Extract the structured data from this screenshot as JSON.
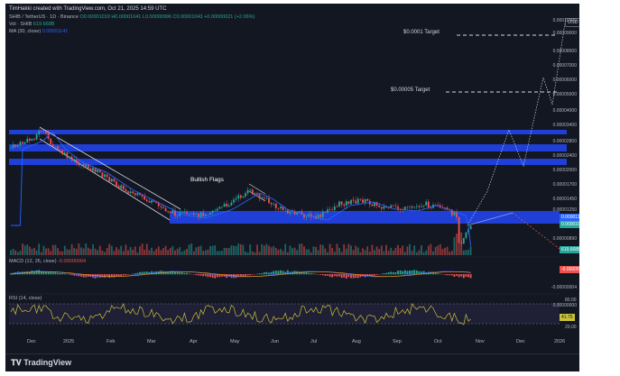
{
  "header": {
    "credit": "TimHakki created with TradingView.com, Oct 21, 2025 14:59 UTC",
    "symbol": "SHIB / TetherUS · 1D · Binance",
    "ohlc": "O0.00001019  H0.00001041  L0.00000996  C0.00001043  +0.00000021 (+2.06%)",
    "vol_label": "Vol · SHIB",
    "vol_value": "619.668B",
    "ma_label": "MA (30, close)",
    "ma_value": "0.00001141",
    "currency": "USDT"
  },
  "price_axis": [
    "0.00010000",
    "0.00009000",
    "0.00008000",
    "0.00007000",
    "0.00006000",
    "0.00005000",
    "0.00004000",
    "0.00003400",
    "0.00002800",
    "0.00002400",
    "0.00002000",
    "0.00001700",
    "0.00001450",
    "0.00001250",
    "0.00000890",
    "0.00000000"
  ],
  "badges": {
    "ma": "0.00001141",
    "price": "0.00001040",
    "volume": "619.668B",
    "macd": "-0.00000004",
    "rsi": "41.75"
  },
  "annotations": {
    "target_high": "$0.0001 Target",
    "target_mid": "$0.00005 Target",
    "pattern": "Bullish Flags"
  },
  "macd": {
    "label": "MACD (12, 26, close)",
    "value": "-0.00000004"
  },
  "rsi": {
    "label": "RSI (14, close)",
    "value": "41.75",
    "upper": "80.00",
    "lower": "20.00"
  },
  "time_axis": [
    "Dec",
    "2025",
    "Feb",
    "Mar",
    "Apr",
    "May",
    "Jun",
    "Jul",
    "Aug",
    "Sep",
    "Oct",
    "Nov",
    "Dec",
    "2026"
  ],
  "footer": {
    "brand": "TradingView"
  },
  "colors": {
    "background": "#131722",
    "zone": "#1f3fd6",
    "ma_line": "#2962ff",
    "up": "#26a69a",
    "down": "#ef5350",
    "rsi_line": "#c9c23a"
  }
}
